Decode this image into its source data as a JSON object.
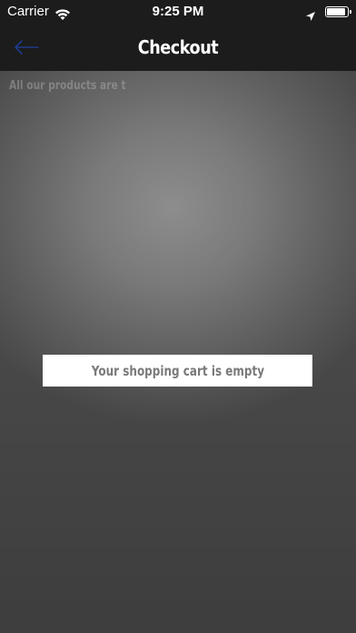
{
  "status_bar": {
    "carrier": "Carrier",
    "time": "9:25 PM",
    "battery_level": 1.0,
    "icons": [
      "wifi-icon",
      "location-arrow-icon",
      "battery-icon"
    ]
  },
  "nav": {
    "back_icon": "arrow-left-icon",
    "title": "Checkout",
    "accent_color": "#1e3a8a"
  },
  "content": {
    "notice": "All our products are t",
    "empty_cart_message": "Your shopping cart is empty"
  }
}
